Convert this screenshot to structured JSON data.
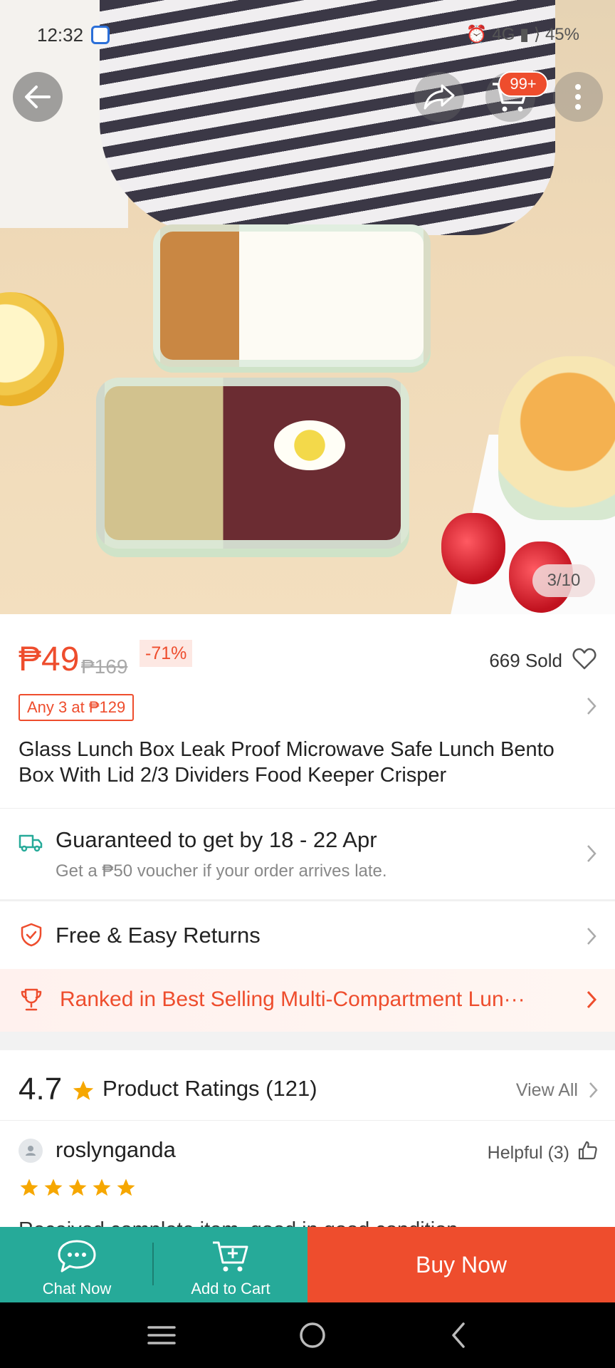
{
  "status_bar": {
    "time": "12:32",
    "right": "⏰ 4G ▮ ⟩ 45%"
  },
  "header": {
    "cart_badge": "99+",
    "image_counter": "3/10"
  },
  "product": {
    "price": "₱49",
    "original_price": "₱169",
    "discount": "-71%",
    "sold": "669 Sold",
    "promo": "Any 3 at ₱129",
    "title": "Glass Lunch Box Leak Proof Microwave Safe Lunch Bento Box With Lid 2/3 Dividers Food Keeper Crisper"
  },
  "shipping": {
    "line1": "Guaranteed to get by 18 - 22 Apr",
    "line2": "Get a ₱50 voucher if your order arrives late."
  },
  "returns": {
    "label": "Free & Easy Returns"
  },
  "ranked": {
    "label": "Ranked in Best Selling Multi-Compartment Lun···"
  },
  "ratings": {
    "score": "4.7",
    "label": "Product Ratings (121)",
    "view_all": "View All",
    "review": {
      "user": "roslynganda",
      "helpful": "Helpful (3)",
      "stars": 5,
      "text": "Received complete item, good in good condition"
    }
  },
  "actions": {
    "chat": "Chat Now",
    "add_to_cart": "Add to Cart",
    "buy": "Buy Now"
  },
  "colors": {
    "accent": "#ee4d2d",
    "teal": "#26aa99"
  }
}
